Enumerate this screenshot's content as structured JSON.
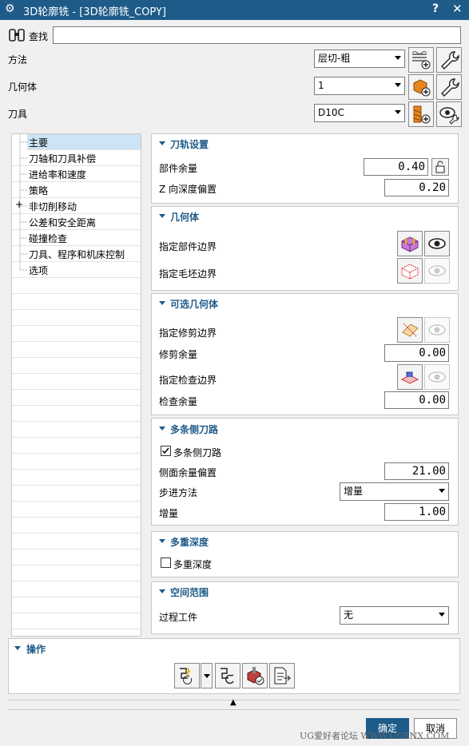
{
  "titlebar": {
    "title": "3D轮廓铣 - [3D轮廓铣_COPY]",
    "help": "?",
    "close": "✕"
  },
  "find": {
    "label": "查找",
    "value": ""
  },
  "method": {
    "label": "方法",
    "value": "层切-粗"
  },
  "geometry": {
    "label": "几何体",
    "value": "1"
  },
  "tool": {
    "label": "刀具",
    "value": "D10C"
  },
  "tree": {
    "items": [
      {
        "label": "主要",
        "selected": true
      },
      {
        "label": "刀轴和刀具补偿"
      },
      {
        "label": "进给率和速度"
      },
      {
        "label": "策略"
      },
      {
        "label": "非切削移动",
        "expandable": true,
        "expand_glyph": "+"
      },
      {
        "label": "公差和安全距离"
      },
      {
        "label": "碰撞检查"
      },
      {
        "label": "刀具、程序和机床控制"
      },
      {
        "label": "选项"
      }
    ]
  },
  "toolpath": {
    "title": "刀轨设置",
    "part_stock": {
      "label": "部件余量",
      "value": "0.40"
    },
    "z_offset": {
      "label": "Z 向深度偏置",
      "value": "0.20"
    }
  },
  "geom_section": {
    "title": "几何体",
    "part_boundary": "指定部件边界",
    "blank_boundary": "指定毛坯边界"
  },
  "optional_geom": {
    "title": "可选几何体",
    "trim_boundary": "指定修剪边界",
    "trim_stock": {
      "label": "修剪余量",
      "value": "0.00"
    },
    "check_boundary": "指定检查边界",
    "check_stock": {
      "label": "检查余量",
      "value": "0.00"
    }
  },
  "multi_passes": {
    "title": "多条侧刀路",
    "checkbox": {
      "label": "多条侧刀路",
      "checked": true
    },
    "side_offset": {
      "label": "侧面余量偏置",
      "value": "21.00"
    },
    "step_method": {
      "label": "步进方法",
      "value": "增量"
    },
    "increment": {
      "label": "增量",
      "value": "1.00"
    }
  },
  "multi_depth": {
    "title": "多重深度",
    "checkbox": {
      "label": "多重深度",
      "checked": false
    }
  },
  "spatial": {
    "title": "空间范围",
    "in_process": {
      "label": "过程工件",
      "value": "无"
    }
  },
  "actions": {
    "title": "操作"
  },
  "footer": {
    "ok": "确定",
    "cancel": "取消",
    "watermark": "UG爱好者论坛 WWW.UGSNX.COM",
    "collapse": "▲"
  },
  "colors": {
    "accent": "#1e5b89",
    "selection": "#cce4f5"
  }
}
